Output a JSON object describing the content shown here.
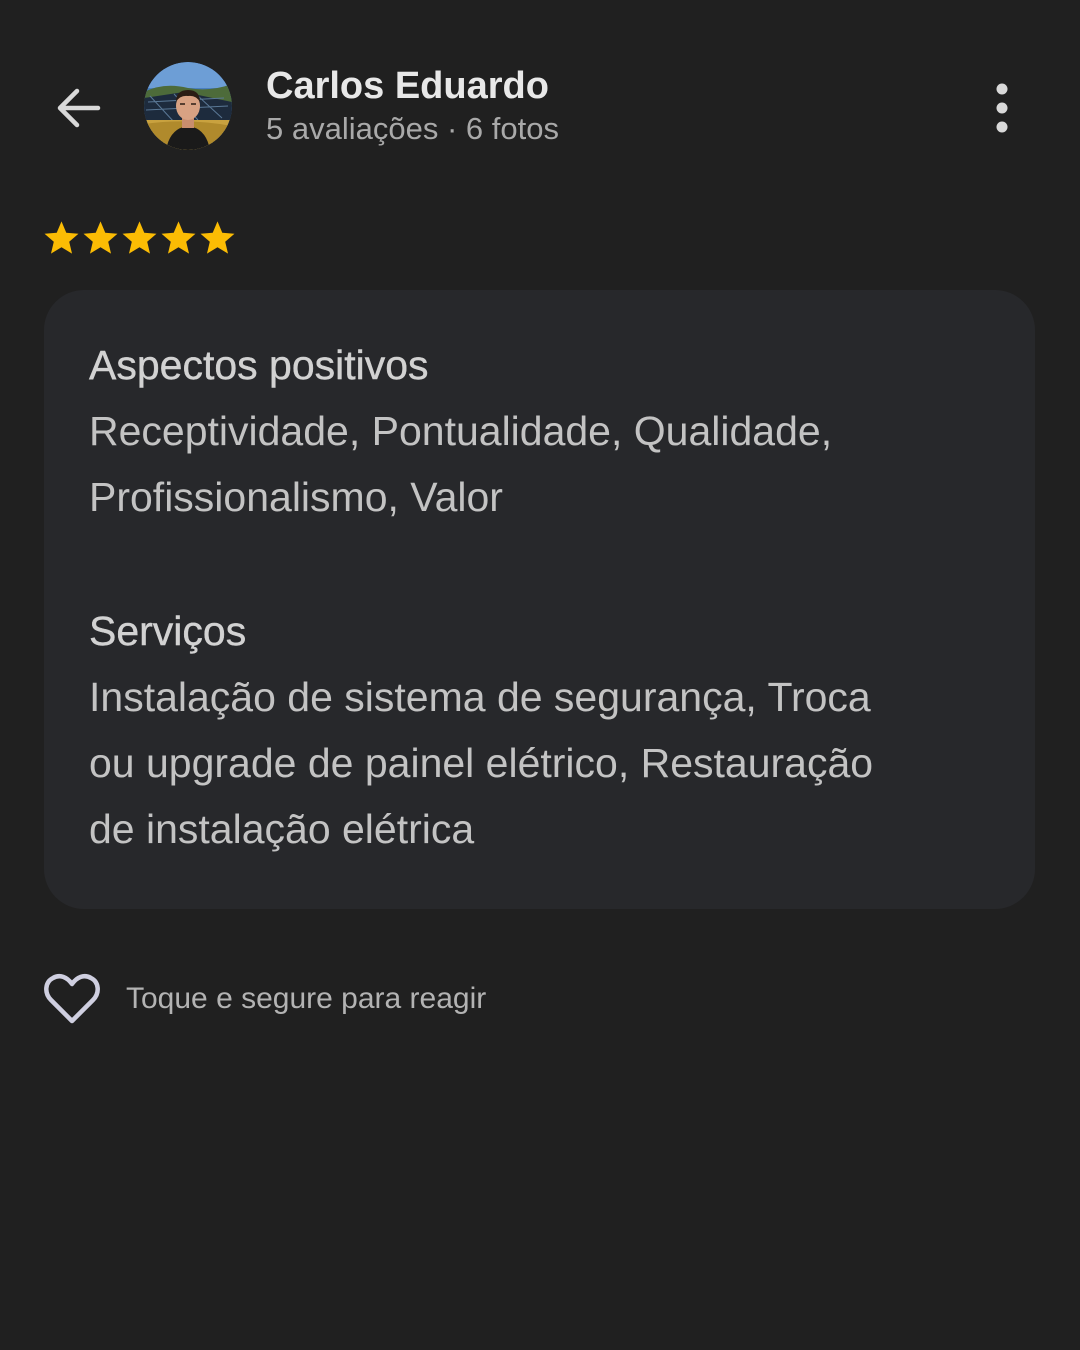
{
  "header": {
    "back_icon": "arrow-left-icon",
    "user_name": "Carlos Eduardo",
    "user_meta": "5 avaliações · 6 fotos",
    "more_icon": "more-vertical-icon"
  },
  "review": {
    "rating": 5,
    "max_rating": 5,
    "star_color": "#FBBC04",
    "sections": [
      {
        "title": "Aspectos positivos",
        "lines": [
          "Receptividade, Pontualidade, Qualidade,",
          "Profissionalismo, Valor"
        ]
      },
      {
        "title": "Serviços",
        "lines": [
          "Instalação de sistema de segurança, Troca",
          "ou upgrade de painel elétrico, Restauração",
          "de instalação elétrica"
        ]
      }
    ]
  },
  "reaction": {
    "icon": "heart-outline-icon",
    "label": "Toque e segure para reagir"
  }
}
